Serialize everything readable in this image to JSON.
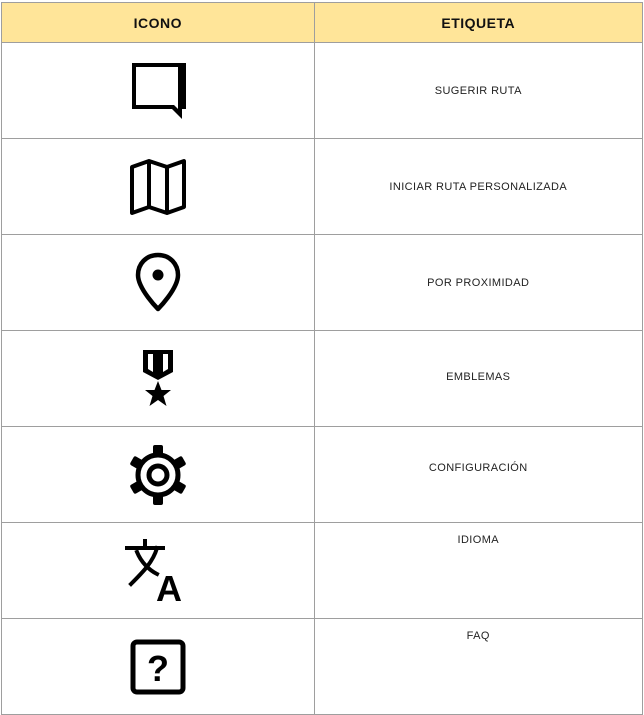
{
  "header": {
    "icon_col": "ICONO",
    "label_col": "ETIQUETA"
  },
  "rows": [
    {
      "icon": "chat-bubble-icon",
      "label": "SUGERIR RUTA"
    },
    {
      "icon": "map-icon",
      "label": "INICIAR RUTA PERSONALIZADA"
    },
    {
      "icon": "location-pin-icon",
      "label": "POR PROXIMIDAD"
    },
    {
      "icon": "military-medal-icon",
      "label": "EMBLEMAS"
    },
    {
      "icon": "gear-icon",
      "label": "CONFIGURACIÓN"
    },
    {
      "icon": "translate-icon",
      "label": "IDIOMA"
    },
    {
      "icon": "question-box-icon",
      "label": "FAQ"
    }
  ]
}
